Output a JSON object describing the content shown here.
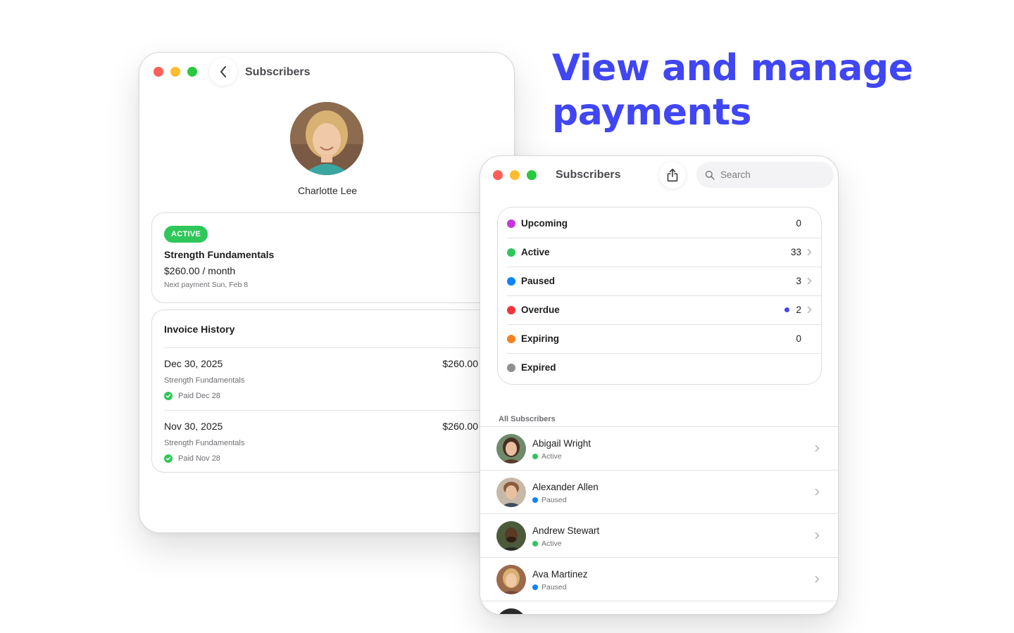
{
  "headline": {
    "line1": "View and manage",
    "line2": "payments"
  },
  "colors": {
    "accent": "#4046f2",
    "active": "#2fc75a",
    "traffic_red": "#ff5f57",
    "traffic_yellow": "#febc2e",
    "traffic_green": "#28c840"
  },
  "detail_window": {
    "title": "Subscribers",
    "back_icon": "chevron-left-icon",
    "profile": {
      "name": "Charlotte Lee"
    },
    "plan": {
      "badge": "ACTIVE",
      "name": "Strength Fundamentals",
      "price": "$260.00 / month",
      "next_payment": "Next payment Sun, Feb 8"
    },
    "invoice_history": {
      "title": "Invoice History",
      "invoices": [
        {
          "date": "Dec 30, 2025",
          "amount": "$260.00",
          "plan": "Strength Fundamentals",
          "paid": "Paid Dec 28"
        },
        {
          "date": "Nov 30, 2025",
          "amount": "$260.00",
          "plan": "Strength Fundamentals",
          "paid": "Paid Nov 28"
        }
      ]
    }
  },
  "list_window": {
    "title": "Subscribers",
    "share_icon": "share-icon",
    "search": {
      "placeholder": "Search",
      "icon": "search-icon"
    },
    "statuses": [
      {
        "label": "Upcoming",
        "count": "0",
        "color": "#c537d8",
        "chevron": false,
        "alert": false
      },
      {
        "label": "Active",
        "count": "33",
        "color": "#2fc75a",
        "chevron": true,
        "alert": false
      },
      {
        "label": "Paused",
        "count": "3",
        "color": "#0a84ff",
        "chevron": true,
        "alert": false
      },
      {
        "label": "Overdue",
        "count": "2",
        "color": "#f2343a",
        "chevron": true,
        "alert": true
      },
      {
        "label": "Expiring",
        "count": "0",
        "color": "#f5821f",
        "chevron": false,
        "alert": false
      },
      {
        "label": "Expired",
        "count": "",
        "color": "#8e8e93",
        "chevron": false,
        "alert": false
      }
    ],
    "section_label": "All Subscribers",
    "subscribers": [
      {
        "name": "Abigail Wright",
        "status": "Active",
        "status_color": "#2fc75a"
      },
      {
        "name": "Alexander Allen",
        "status": "Paused",
        "status_color": "#0a84ff"
      },
      {
        "name": "Andrew Stewart",
        "status": "Active",
        "status_color": "#2fc75a"
      },
      {
        "name": "Ava Martinez",
        "status": "Paused",
        "status_color": "#0a84ff"
      }
    ]
  }
}
